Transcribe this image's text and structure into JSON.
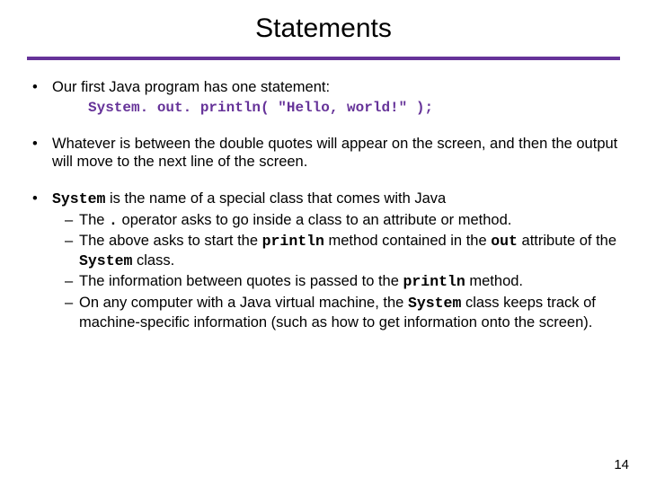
{
  "title": "Statements",
  "bullets": [
    {
      "text": "Our first Java program has one statement:",
      "code": "System. out. println( \"Hello, world!\" );"
    },
    {
      "text": "Whatever is between the double quotes will appear on the screen, and then the output will move to the next line of the screen."
    },
    {
      "pre": "",
      "code1": "System",
      "post": " is the name of a special class that comes with Java",
      "subs": [
        {
          "p1": "The ",
          "c1": ".",
          "p2": " operator asks to go inside a class to an attribute or method."
        },
        {
          "p1": "The above asks to start the ",
          "c1": "println",
          "p2": " method contained in the ",
          "c2": "out",
          "p3": " attribute of the ",
          "c3": "System",
          "p4": " class."
        },
        {
          "p1": "The information between quotes is passed to the ",
          "c1": "println",
          "p2": " method."
        },
        {
          "p1": "On any computer with a Java virtual machine, the ",
          "c1": "System",
          "p2": " class keeps track of machine-specific information (such as how to get information onto the screen)."
        }
      ]
    }
  ],
  "pageNum": "14",
  "bulletChar": "•",
  "dashChar": "–"
}
